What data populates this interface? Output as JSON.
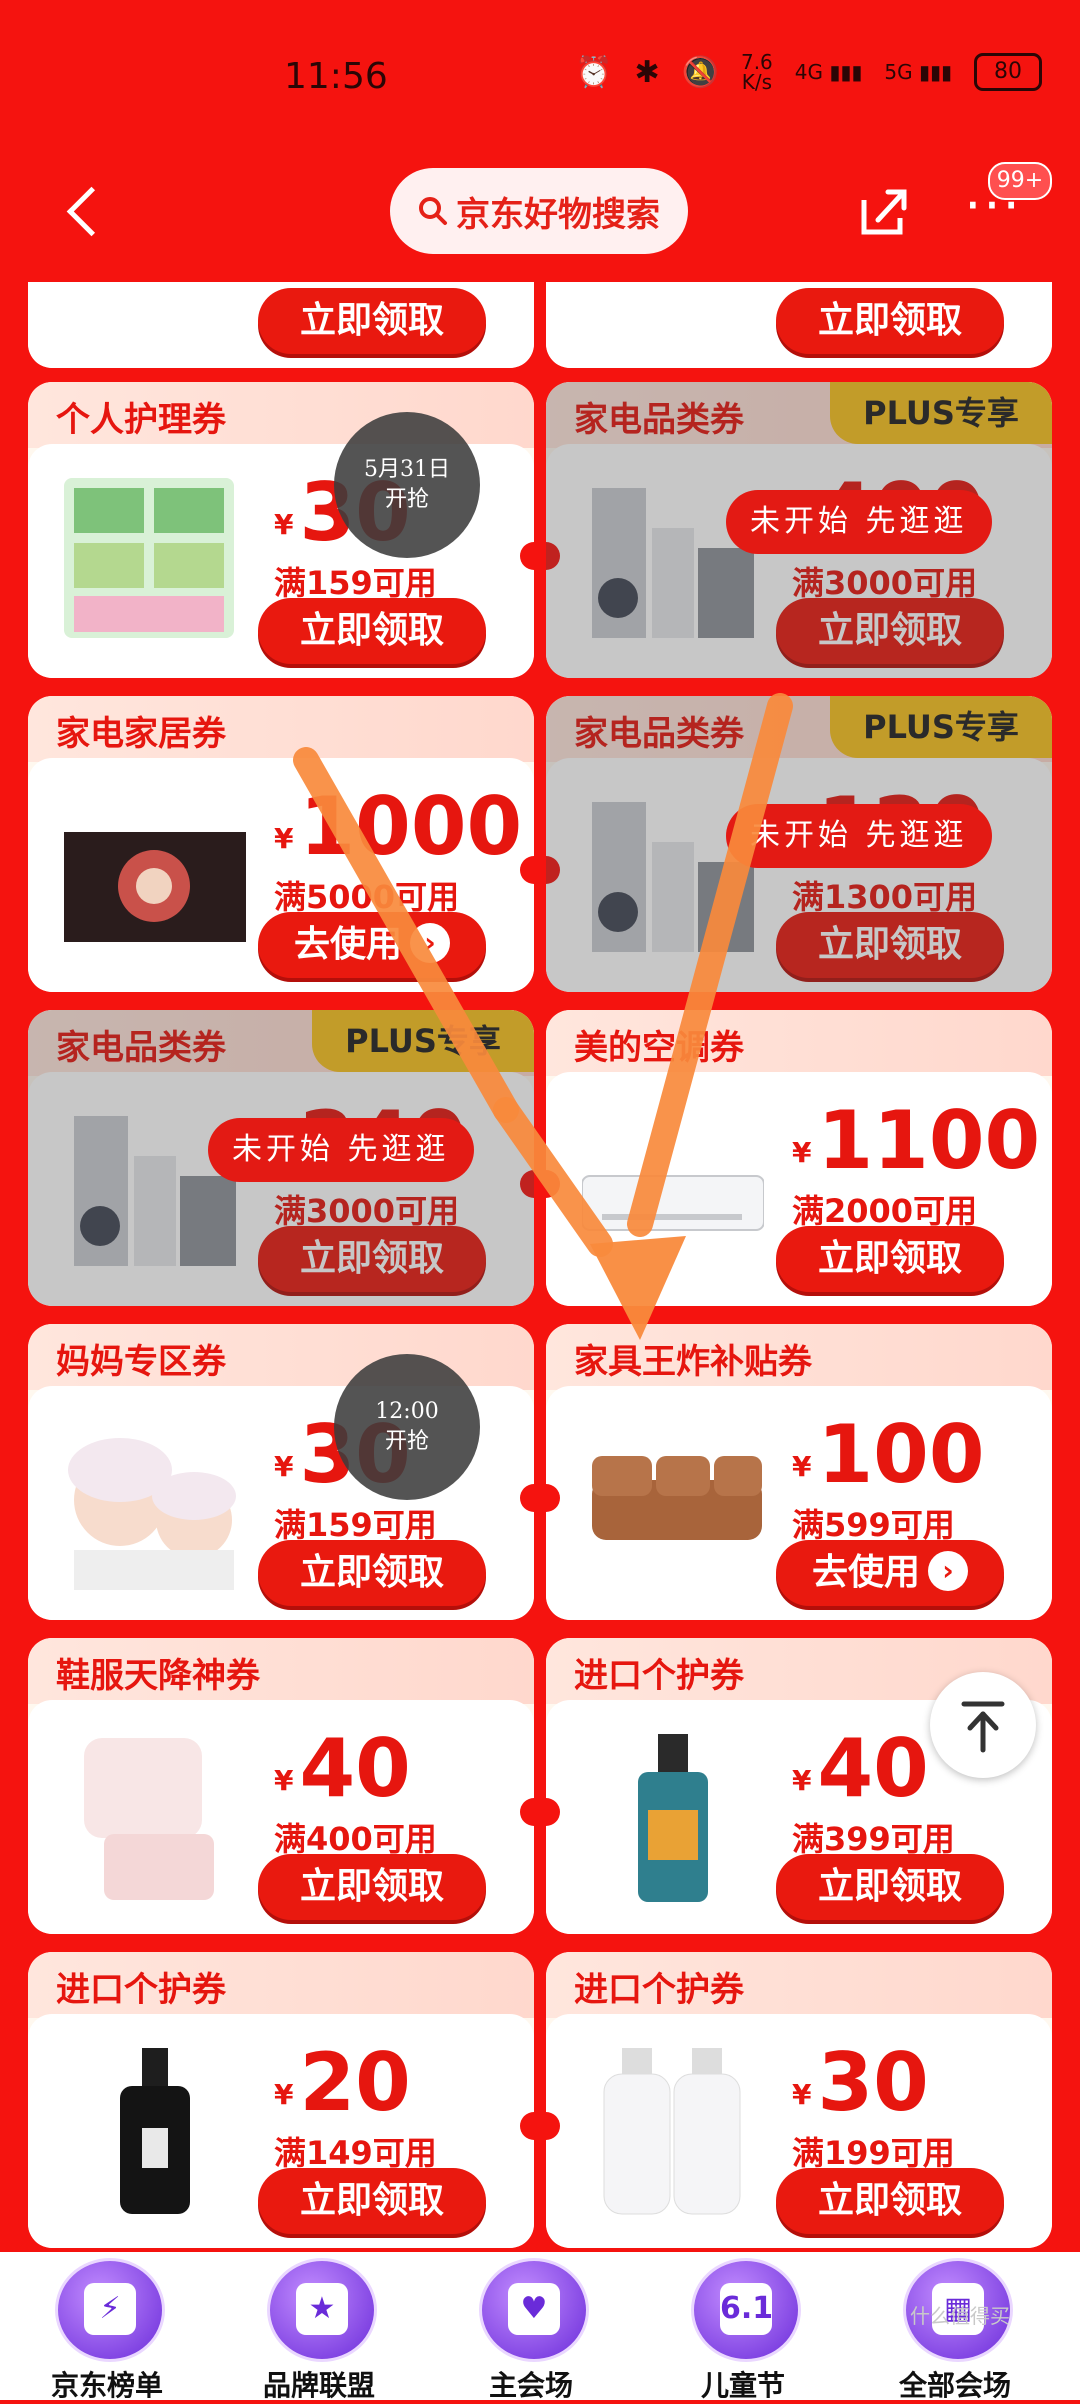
{
  "status": {
    "time": "11:56",
    "speed": "7.6\nK/s",
    "net1": "4G",
    "net2": "5G",
    "battery": "80"
  },
  "topbar": {
    "search_label": "京东好物搜索",
    "badge": "99+",
    "more": "···"
  },
  "partial_row": {
    "btn_left": "立即领取",
    "btn_right": "立即领取"
  },
  "cards": [
    {
      "title": "个人护理券",
      "yen": "¥",
      "amount": "30",
      "cond": "满159可用",
      "btn": "立即领取",
      "state": "countdown",
      "state_text": "5月31日\n开抢"
    },
    {
      "title": "家电品类券",
      "plus": "PLUS专享",
      "yen": "¥",
      "amount": "400",
      "cond": "满3000可用",
      "btn": "立即领取",
      "state": "pill",
      "state_text": "未开始 先逛逛"
    },
    {
      "title": "家电家居券",
      "yen": "¥",
      "amount": "1000",
      "cond": "满5000可用",
      "btn": "去使用",
      "state": "none"
    },
    {
      "title": "家电品类券",
      "plus": "PLUS专享",
      "yen": "¥",
      "amount": "120",
      "cond": "满1300可用",
      "btn": "立即领取",
      "state": "pill",
      "state_text": "未开始 先逛逛"
    },
    {
      "title": "家电品类券",
      "plus": "PLUS专享",
      "yen": "¥",
      "amount": "240",
      "cond": "满3000可用",
      "btn": "立即领取",
      "state": "pill",
      "state_text": "未开始 先逛逛"
    },
    {
      "title": "美的空调券",
      "yen": "¥",
      "amount": "1100",
      "cond": "满2000可用",
      "btn": "立即领取",
      "state": "none"
    },
    {
      "title": "妈妈专区券",
      "yen": "¥",
      "amount": "30",
      "cond": "满159可用",
      "btn": "立即领取",
      "state": "countdown",
      "state_text": "12:00\n开抢"
    },
    {
      "title": "家具王炸补贴券",
      "yen": "¥",
      "amount": "100",
      "cond": "满599可用",
      "btn": "去使用",
      "state": "none"
    },
    {
      "title": "鞋服天降神券",
      "yen": "¥",
      "amount": "40",
      "cond": "满400可用",
      "btn": "立即领取",
      "state": "none"
    },
    {
      "title": "进口个护券",
      "yen": "¥",
      "amount": "40",
      "cond": "满399可用",
      "btn": "立即领取",
      "state": "none"
    },
    {
      "title": "进口个护券",
      "yen": "¥",
      "amount": "20",
      "cond": "满149可用",
      "btn": "立即领取",
      "state": "none"
    },
    {
      "title": "进口个护券",
      "yen": "¥",
      "amount": "30",
      "cond": "满199可用",
      "btn": "立即领取",
      "state": "none"
    }
  ],
  "bottom_nav": [
    {
      "label": "京东榜单",
      "glyph": "⚡"
    },
    {
      "label": "品牌联盟",
      "glyph": "★"
    },
    {
      "label": "主会场",
      "glyph": "♥"
    },
    {
      "label": "儿童节",
      "glyph": "6.1"
    },
    {
      "label": "全部会场",
      "glyph": "▦"
    }
  ],
  "watermark": "什么值得买",
  "colors": {
    "background": "#f5130f",
    "accent": "#e6160f",
    "plus": "#f8c21d",
    "arrow": "#f98a3c"
  }
}
